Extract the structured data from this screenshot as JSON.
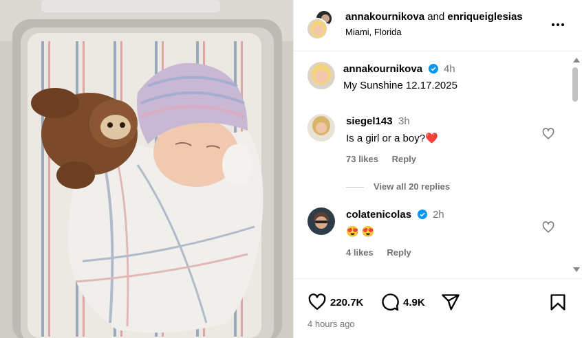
{
  "header": {
    "author": "annakournikova",
    "conjunction": "and",
    "coauthor": "enriqueiglesias",
    "location": "Miami, Florida"
  },
  "caption": {
    "username": "annakournikova",
    "time": "4h",
    "text": "My Sunshine 12.17.2025"
  },
  "comments": [
    {
      "username": "siegel143",
      "time": "3h",
      "text": "Is a girl or a boy?❤️",
      "likes": "73 likes",
      "reply_label": "Reply",
      "view_replies": "View all 20 replies"
    },
    {
      "username": "colatenicolas",
      "time": "2h",
      "text": "😍 😍",
      "likes": "4 likes",
      "reply_label": "Reply"
    }
  ],
  "actions": {
    "likes_count": "220.7K",
    "comments_count": "4.9K",
    "posted": "4 hours ago"
  },
  "colors": {
    "verified": "#0095f6",
    "secondary_text": "#737373",
    "heart_emoji": "#ed2e5b"
  },
  "icons": [
    "more-icon",
    "verified-icon",
    "heart-icon",
    "comment-icon",
    "share-icon",
    "bookmark-icon"
  ]
}
